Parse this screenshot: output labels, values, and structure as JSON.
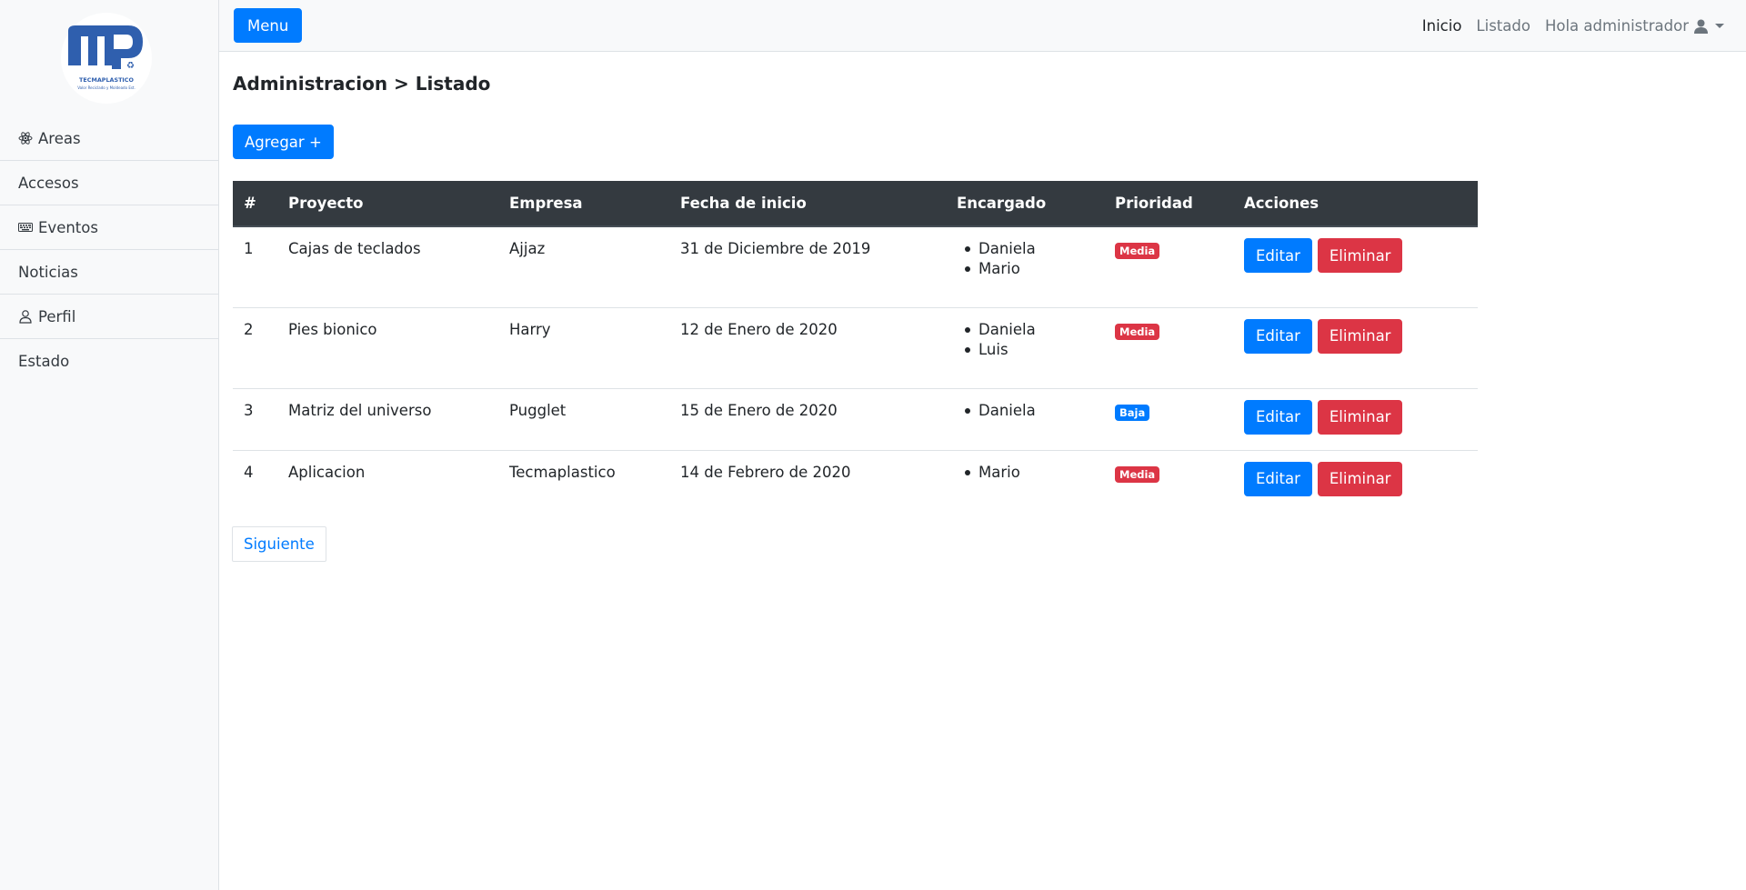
{
  "logo": {
    "brand": "TECMAPLASTICO",
    "tagline": "Valor Reciclado y Moldeado Est."
  },
  "sidebar": {
    "items": [
      {
        "label": "Areas",
        "icon": "atom-icon"
      },
      {
        "label": "Accesos",
        "icon": ""
      },
      {
        "label": "Eventos",
        "icon": "keyboard-icon"
      },
      {
        "label": "Noticias",
        "icon": ""
      },
      {
        "label": "Perfil",
        "icon": "user-outline-icon"
      },
      {
        "label": "Estado",
        "icon": ""
      }
    ]
  },
  "topnav": {
    "menu_label": "Menu",
    "links": [
      "Inicio",
      "Listado"
    ],
    "user_label": "Hola administrador"
  },
  "main": {
    "breadcrumb": "Administracion > Listado",
    "add_label": "Agregar +",
    "next_label": "Siguiente"
  },
  "table": {
    "headers": [
      "#",
      "Proyecto",
      "Empresa",
      "Fecha de inicio",
      "Encargado",
      "Prioridad",
      "Acciones"
    ],
    "edit_label": "Editar",
    "delete_label": "Eliminar",
    "rows": [
      {
        "num": "1",
        "proyecto": "Cajas de teclados",
        "empresa": "Ajjaz",
        "fecha": "31 de Diciembre de 2019",
        "encargados": [
          "Daniela",
          "Mario"
        ],
        "prioridad": "Media",
        "prioridad_color": "#dc3545"
      },
      {
        "num": "2",
        "proyecto": "Pies bionico",
        "empresa": "Harry",
        "fecha": "12 de Enero de 2020",
        "encargados": [
          "Daniela",
          "Luis"
        ],
        "prioridad": "Media",
        "prioridad_color": "#dc3545"
      },
      {
        "num": "3",
        "proyecto": "Matriz del universo",
        "empresa": "Pugglet",
        "fecha": "15 de Enero de 2020",
        "encargados": [
          "Daniela"
        ],
        "prioridad": "Baja",
        "prioridad_color": "#007bff"
      },
      {
        "num": "4",
        "proyecto": "Aplicacion",
        "empresa": "Tecmaplastico",
        "fecha": "14 de Febrero de 2020",
        "encargados": [
          "Mario"
        ],
        "prioridad": "Media",
        "prioridad_color": "#dc3545"
      }
    ]
  },
  "colors": {
    "primary": "#007bff",
    "danger": "#dc3545",
    "dark": "#343a40",
    "light": "#f8f9fa"
  }
}
